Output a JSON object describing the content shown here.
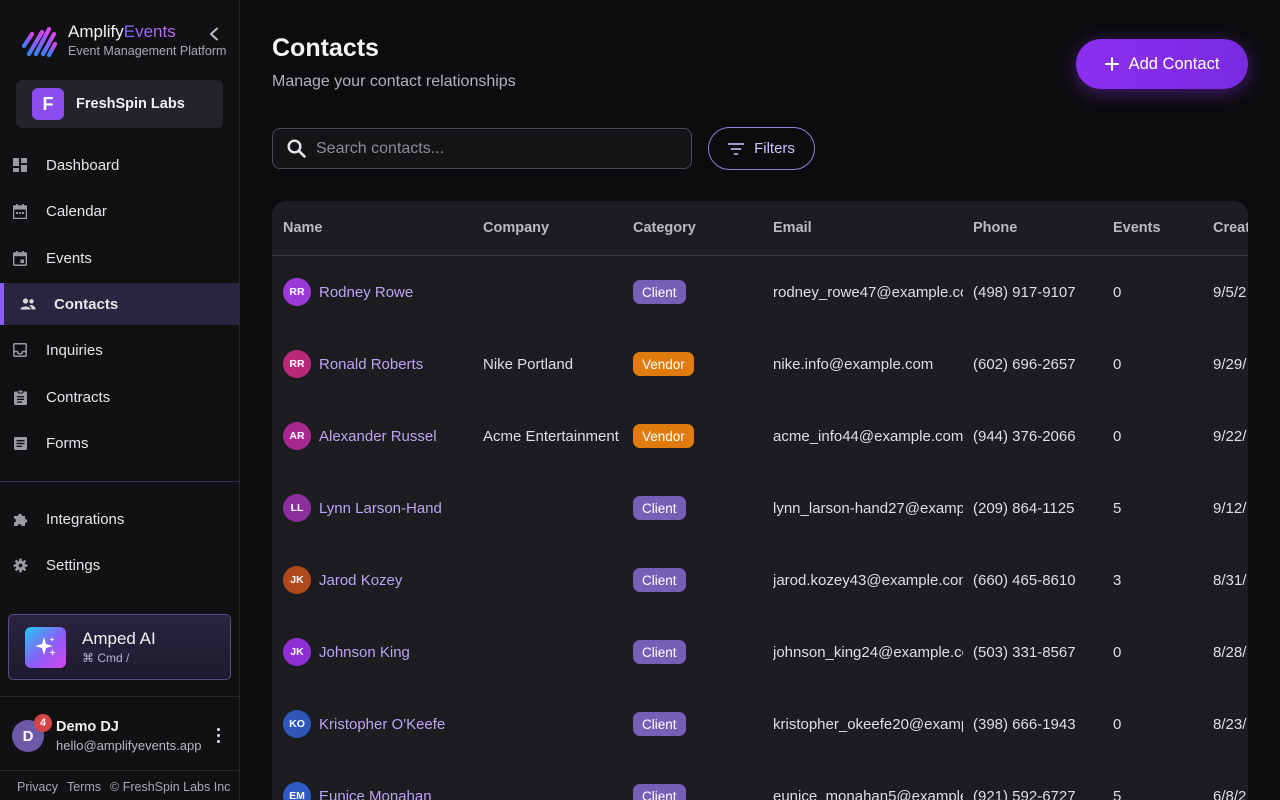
{
  "brand": {
    "name_part1": "Amplify",
    "name_part2": "Events",
    "subtitle": "Event Management Platform"
  },
  "org": {
    "initial": "F",
    "name": "FreshSpin Labs"
  },
  "nav": {
    "items": [
      {
        "label": "Dashboard",
        "icon": "dashboard-icon"
      },
      {
        "label": "Calendar",
        "icon": "calendar-icon"
      },
      {
        "label": "Events",
        "icon": "event-icon"
      },
      {
        "label": "Contacts",
        "icon": "people-icon",
        "active": true
      },
      {
        "label": "Inquiries",
        "icon": "inbox-icon"
      },
      {
        "label": "Contracts",
        "icon": "clipboard-icon"
      },
      {
        "label": "Forms",
        "icon": "form-icon"
      }
    ],
    "secondary": [
      {
        "label": "Integrations",
        "icon": "puzzle-icon"
      },
      {
        "label": "Settings",
        "icon": "gear-icon"
      }
    ]
  },
  "ai": {
    "title": "Amped AI",
    "shortcut": "⌘ Cmd /"
  },
  "user": {
    "initial": "D",
    "notifications": "4",
    "name": "Demo DJ",
    "email": "hello@amplifyevents.app"
  },
  "footer": {
    "privacy": "Privacy",
    "terms": "Terms",
    "copyright": "© FreshSpin Labs Inc"
  },
  "page": {
    "title": "Contacts",
    "subtitle": "Manage your contact relationships",
    "add_label": "Add Contact"
  },
  "search": {
    "placeholder": "Search contacts..."
  },
  "filters": {
    "label": "Filters"
  },
  "table": {
    "columns": [
      "Name",
      "Company",
      "Category",
      "Email",
      "Phone",
      "Events",
      "Creat"
    ],
    "rows": [
      {
        "initials": "RR",
        "avatar_color": "#9b3ad8",
        "name": "Rodney Rowe",
        "company": "",
        "category": "Client",
        "email": "rodney_rowe47@example.co",
        "phone": "(498) 917-9107",
        "events": "0",
        "created": "9/5/2"
      },
      {
        "initials": "RR",
        "avatar_color": "#b8297a",
        "name": "Ronald Roberts",
        "company": "Nike Portland",
        "category": "Vendor",
        "email": "nike.info@example.com",
        "phone": "(602) 696-2657",
        "events": "0",
        "created": "9/29/"
      },
      {
        "initials": "AR",
        "avatar_color": "#a7278f",
        "name": "Alexander Russel",
        "company": "Acme Entertainment",
        "category": "Vendor",
        "email": "acme_info44@example.com",
        "phone": "(944) 376-2066",
        "events": "0",
        "created": "9/22/"
      },
      {
        "initials": "LL",
        "avatar_color": "#8a2f9c",
        "name": "Lynn Larson-Hand",
        "company": "",
        "category": "Client",
        "email": "lynn_larson-hand27@examp",
        "phone": "(209) 864-1125",
        "events": "5",
        "created": "9/12/"
      },
      {
        "initials": "JK",
        "avatar_color": "#b04a1e",
        "name": "Jarod Kozey",
        "company": "",
        "category": "Client",
        "email": "jarod.kozey43@example.con",
        "phone": "(660) 465-8610",
        "events": "3",
        "created": "8/31/"
      },
      {
        "initials": "JK",
        "avatar_color": "#8d2fd4",
        "name": "Johnson King",
        "company": "",
        "category": "Client",
        "email": "johnson_king24@example.cc",
        "phone": "(503) 331-8567",
        "events": "0",
        "created": "8/28/"
      },
      {
        "initials": "KO",
        "avatar_color": "#2f57b8",
        "name": "Kristopher O'Keefe",
        "company": "",
        "category": "Client",
        "email": "kristopher_okeefe20@examp",
        "phone": "(398) 666-1943",
        "events": "0",
        "created": "8/23/"
      },
      {
        "initials": "EM",
        "avatar_color": "#2f5ac4",
        "name": "Eunice Monahan",
        "company": "",
        "category": "Client",
        "email": "eunice_monahan5@example",
        "phone": "(921) 592-6727",
        "events": "5",
        "created": "6/8/2"
      }
    ]
  },
  "colors": {
    "accent": "#8b5cf6",
    "client_badge": "#7560b8",
    "vendor_badge": "#e07c0e",
    "background": "#0c0c0e"
  }
}
